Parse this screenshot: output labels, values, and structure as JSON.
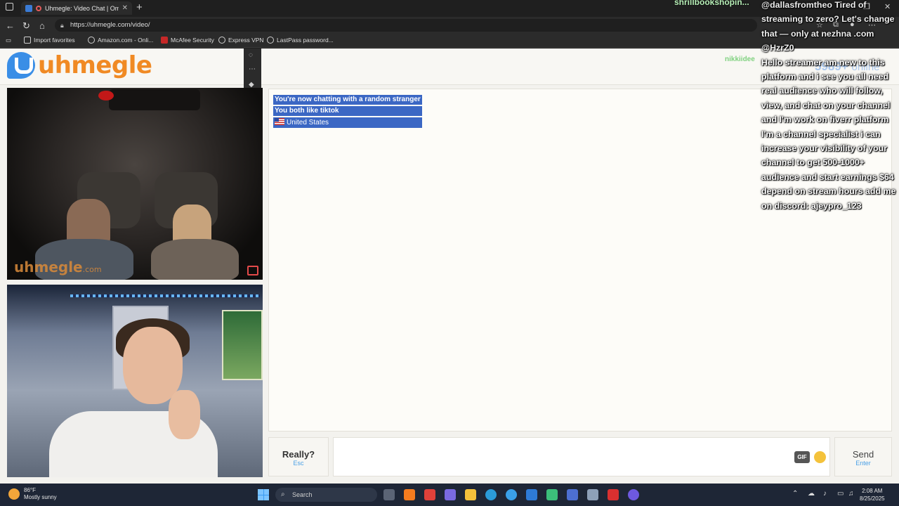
{
  "browser": {
    "tab_title": "Uhmegle: Video Chat | Ome",
    "url": "https://uhmegle.com/video/",
    "favorites": [
      {
        "label": "Import favorites"
      },
      {
        "label": "Amazon.com - Onli..."
      },
      {
        "label": "McAfee Security"
      },
      {
        "label": "Express VPN"
      },
      {
        "label": "LastPass password..."
      }
    ]
  },
  "site": {
    "logo_text": "uhmegle",
    "online_count": "5989+",
    "online_label": "online",
    "username_tag": "nikkiidee"
  },
  "videos": {
    "watermark": "uhmegle",
    "watermark_suffix": ".com"
  },
  "chat": {
    "system_messages": [
      "You're now chatting with a random stranger",
      "You both like tiktok"
    ],
    "country": "United States"
  },
  "controls": {
    "skip_label": "Really?",
    "skip_hint": "Esc",
    "gif_label": "GIF",
    "send_label": "Send",
    "send_hint": "Enter"
  },
  "stream_overlay": {
    "top_name": "shrillbookshopin...",
    "message1": "@dallasfromtheo Tired of streaming to zero? Let's change that — only at nezhna .com @HzrZ0",
    "message2": "Hello streamer am new to this platform and i see you all need real audience who will follow, view, and chat on your channel and I'm work on fiverr platform I'm a channel specialist i can increase your visibility of your channel to get 500-1000+ audience and start earnings $64 depend on stream hours add me on discord: ajeypro_123"
  },
  "taskbar": {
    "temperature": "86°F",
    "weather": "Mostly sunny",
    "search_placeholder": "Search",
    "time": "2:08 AM",
    "date": "8/25/2025"
  }
}
